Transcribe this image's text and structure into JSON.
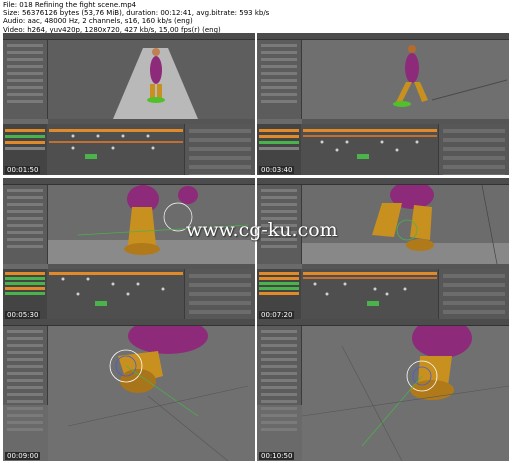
{
  "header": {
    "file": "File: 018 Refining the fight scene.mp4",
    "size": "Size: 56376126 bytes (53,76 MiB), duration: 00:12:41, avg.bitrate: 593 kb/s",
    "audio": "Audio: aac, 48000 Hz, 2 channels, s16, 160 kb/s (eng)",
    "video": "Video: h264, yuv420p, 1280x720, 427 kb/s, 15,00 fps(r) (eng)"
  },
  "watermark": "www.cg-ku.com",
  "thumbnails": [
    {
      "timecode": "00:01:50"
    },
    {
      "timecode": "00:03:40"
    },
    {
      "timecode": "00:05:30"
    },
    {
      "timecode": "00:07:20"
    },
    {
      "timecode": "00:09:00"
    },
    {
      "timecode": "00:10:50"
    }
  ],
  "colors": {
    "accent_orange": "#e08a2a",
    "key_green": "#4bb34b",
    "panel_gray": "#6a6a6a"
  }
}
